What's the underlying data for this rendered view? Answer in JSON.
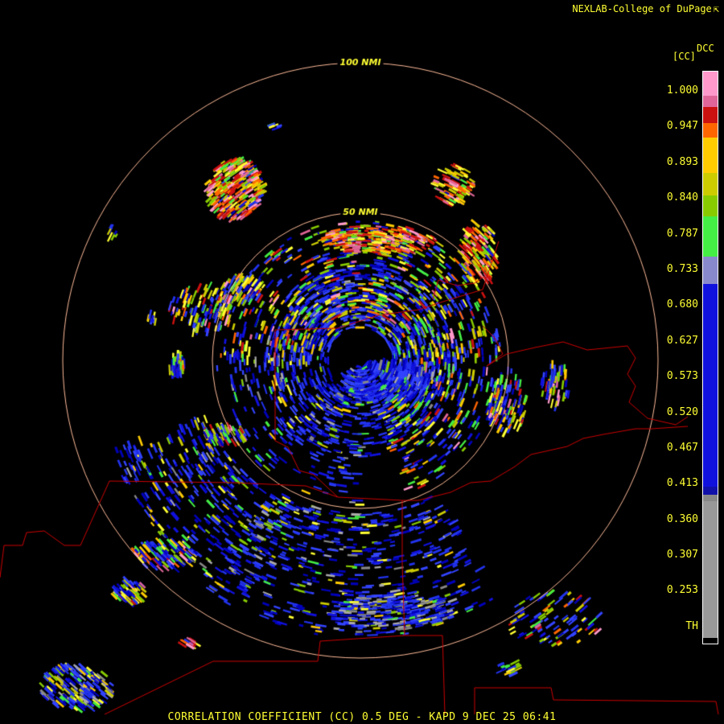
{
  "credit": {
    "text": "NEXLAB-College of DuPage",
    "link_icon": "external-link-icon"
  },
  "colorbar": {
    "product": "DCC",
    "unit": "[CC]",
    "labels": [
      "1.000",
      "0.947",
      "0.893",
      "0.840",
      "0.787",
      "0.733",
      "0.680",
      "0.627",
      "0.573",
      "0.520",
      "0.467",
      "0.413",
      "0.360",
      "0.307",
      "0.253",
      "TH"
    ],
    "colors": [
      "#ff99cc",
      "#e06699",
      "#cc1111",
      "#ff6600",
      "#ffcc00",
      "#cccc00",
      "#88cc00",
      "#44ee44",
      "#8888cc",
      "#1111dd",
      "#1111aa",
      "#888888",
      "#999999",
      "#000000"
    ]
  },
  "range_rings": {
    "outer_label": "100 NMI",
    "inner_label": "50 NMI"
  },
  "footer": "CORRELATION COEFFICIENT (CC) 0.5 DEG - KAPD 9 DEC 25 06:41",
  "colors": {
    "ring": "#ffbb99",
    "boundary": "#cc0000",
    "text": "#ffff33"
  }
}
